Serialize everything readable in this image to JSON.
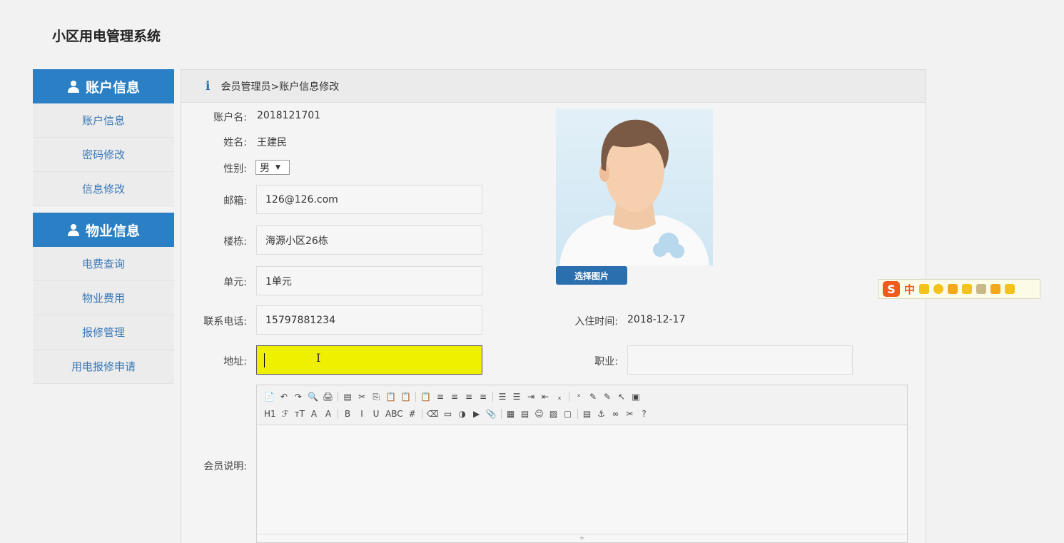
{
  "app": {
    "title": "小区用电管理系统"
  },
  "sidebar": {
    "groups": [
      {
        "title": "账户信息",
        "items": [
          "账户信息",
          "密码修改",
          "信息修改"
        ]
      },
      {
        "title": "物业信息",
        "items": [
          "电费查询",
          "物业费用",
          "报修管理",
          "用电报修申请"
        ]
      }
    ]
  },
  "breadcrumb": {
    "icon": "i",
    "text": "会员管理员>账户信息修改"
  },
  "form": {
    "account": {
      "label": "账户名:",
      "value": "2018121701"
    },
    "name": {
      "label": "姓名:",
      "value": "王建民"
    },
    "gender": {
      "label": "性别:",
      "value": "男"
    },
    "email": {
      "label": "邮箱:",
      "value": "126@126.com"
    },
    "building": {
      "label": "楼栋:",
      "value": "海源小区26栋"
    },
    "unit": {
      "label": "单元:",
      "value": "1单元"
    },
    "phone": {
      "label": "联系电话:",
      "value": "15797881234"
    },
    "movein": {
      "label": "入住时间:",
      "value": "2018-12-17"
    },
    "address": {
      "label": "地址:",
      "value": ""
    },
    "job": {
      "label": "职业:",
      "value": ""
    },
    "remark": {
      "label": "会员说明:"
    },
    "pick_button": "选择图片"
  },
  "editor": {
    "row1": [
      "📄",
      "↶",
      "↷",
      "🔍",
      "🖨",
      "▤",
      "✂",
      "⎘",
      "📋",
      "📋",
      "📋",
      "≡",
      "≡",
      "≡",
      "≡",
      "☰",
      "☰",
      "⇥",
      "⇤",
      "ₓ",
      "ˣ",
      "✎",
      "✎",
      "↖",
      "▣"
    ],
    "row2": [
      "H1",
      "ℱ",
      "тT",
      "A",
      "A",
      "B",
      "I",
      "U",
      "ABC",
      "#",
      "⌫",
      "▭",
      "◑",
      "▶",
      "📎",
      "▦",
      "▤",
      "☺",
      "▨",
      "▢",
      "▤",
      "⚓",
      "∞",
      "✂",
      "?"
    ],
    "resize_glyph": "÷"
  },
  "ime": {
    "logo": "S",
    "lang": "中"
  },
  "colors": {
    "accent": "#2b7fc4",
    "active_field": "#eef000"
  }
}
